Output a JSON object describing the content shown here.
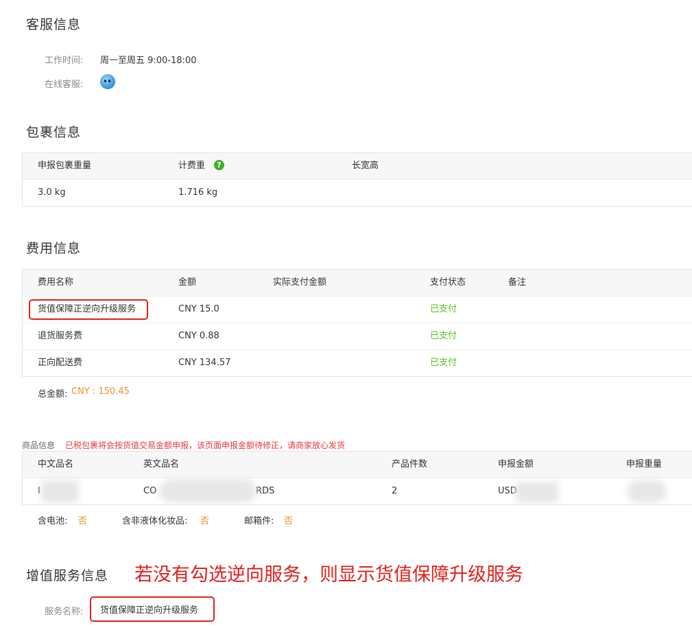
{
  "customer_service": {
    "title": "客服信息",
    "hours_label": "工作时间:",
    "hours_value": "周一至周五 9:00-18:00",
    "online_label": "在线客服:",
    "online_icon": "qq-icon"
  },
  "package": {
    "title": "包裹信息",
    "headers": [
      "申报包裹重量",
      "计费重",
      "长宽高"
    ],
    "values": [
      "3.0 kg",
      "1.716 kg",
      ""
    ],
    "help_glyph": "?"
  },
  "fees": {
    "title": "费用信息",
    "headers": [
      "费用名称",
      "金额",
      "实际支付金额",
      "支付状态",
      "备注"
    ],
    "rows": [
      {
        "name": "货值保障正逆向升级服务",
        "amount": "CNY 15.0",
        "actual": "",
        "status": "已支付",
        "note": ""
      },
      {
        "name": "退货服务费",
        "amount": "CNY 0.88",
        "actual": "",
        "status": "已支付",
        "note": ""
      },
      {
        "name": "正向配送费",
        "amount": "CNY 134.57",
        "actual": "",
        "status": "已支付",
        "note": ""
      }
    ],
    "total_label": "总金额:",
    "total_value": "CNY : 150.45",
    "status_color": "#52c41a"
  },
  "products": {
    "title": "商品信息",
    "notice": "已税包裹将会按货值交易金额申报，该页面申报金额待修正，请商家放心发货",
    "headers": [
      "中文品名",
      "英文品名",
      "产品件数",
      "申报金额",
      "申报重量"
    ],
    "row": {
      "cn_name": "I",
      "en_name_start": "CO",
      "en_name_end": "RDS",
      "qty": "2",
      "amount": "USD",
      "weight": ""
    },
    "attrs": [
      {
        "label": "含电池:",
        "value": "否"
      },
      {
        "label": "含非液体化妆品:",
        "value": "否"
      },
      {
        "label": "邮箱件:",
        "value": "否"
      }
    ]
  },
  "value_added": {
    "title": "增值服务信息",
    "annotation": "若没有勾选逆向服务，则显示货值保障升级服务",
    "service_label": "服务名称:",
    "service_value": "货值保障正逆向升级服务"
  },
  "colors": {
    "accent_orange": "#f08c2e",
    "annotation_red": "#e0201c",
    "paid_green": "#52c41a"
  }
}
